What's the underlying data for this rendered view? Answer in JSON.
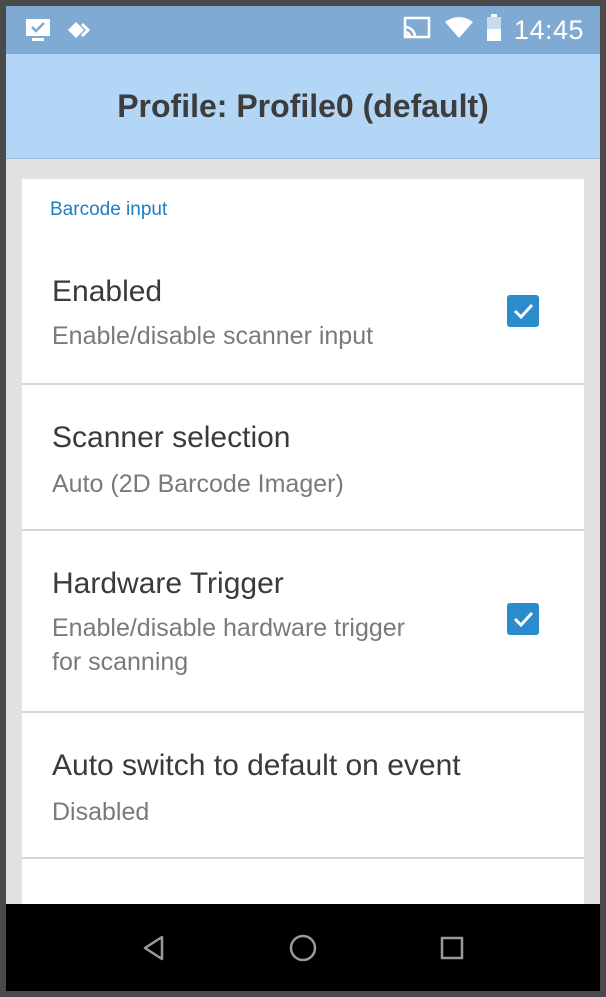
{
  "status_bar": {
    "time": "14:45",
    "icons": [
      "notification-icon",
      "app-icon",
      "cast-icon",
      "wifi-icon",
      "battery-icon"
    ]
  },
  "app_bar": {
    "title": "Profile: Profile0 (default)"
  },
  "section": {
    "header": "Barcode input"
  },
  "settings": [
    {
      "title": "Enabled",
      "subtitle": "Enable/disable scanner input",
      "checked": true
    },
    {
      "title": "Scanner selection",
      "subtitle": "Auto (2D Barcode Imager)"
    },
    {
      "title": "Hardware Trigger",
      "subtitle": "Enable/disable hardware trigger for scanning",
      "checked": true
    },
    {
      "title": "Auto switch to default on event",
      "subtitle": "Disabled"
    }
  ],
  "nav_bar": {
    "buttons": [
      "back-icon",
      "home-icon",
      "recents-icon"
    ]
  },
  "colors": {
    "status_bar": "#7faad3",
    "app_bar": "#b3d6f6",
    "accent": "#2a8ccd",
    "section_header": "#1a7fbf"
  }
}
